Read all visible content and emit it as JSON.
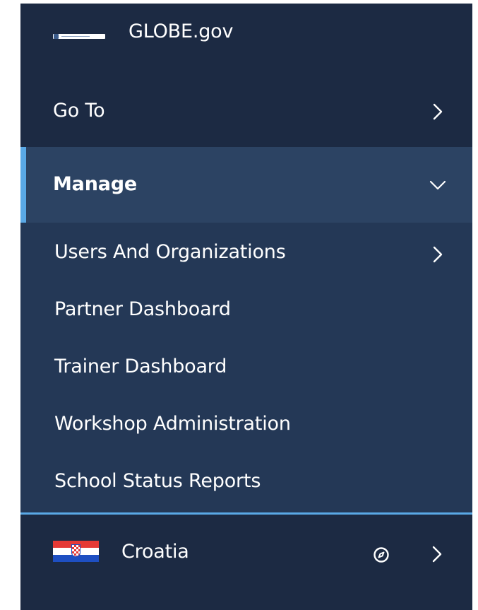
{
  "header": {
    "brand": "GLOBE.gov",
    "logo_icon": "globe-program-logo-icon"
  },
  "nav": {
    "goto": {
      "label": "Go To",
      "icon": "chevron-right-icon",
      "expanded": false
    },
    "manage": {
      "label": "Manage",
      "icon": "chevron-down-icon",
      "expanded": true,
      "items": [
        {
          "label": "Users And Organizations",
          "icon": "chevron-right-icon"
        },
        {
          "label": "Partner Dashboard"
        },
        {
          "label": "Trainer Dashboard"
        },
        {
          "label": "Workshop Administration"
        },
        {
          "label": "School Status Reports"
        }
      ]
    }
  },
  "footer": {
    "country": "Croatia",
    "flag_icon": "croatia-flag-icon",
    "compass_icon": "compass-icon",
    "chevron_icon": "chevron-right-icon"
  },
  "colors": {
    "menu_bg": "#1c2a43",
    "submenu_bg": "#243856",
    "active_bg": "#2c4363",
    "accent": "#5aa9e6",
    "text": "#ffffff"
  }
}
